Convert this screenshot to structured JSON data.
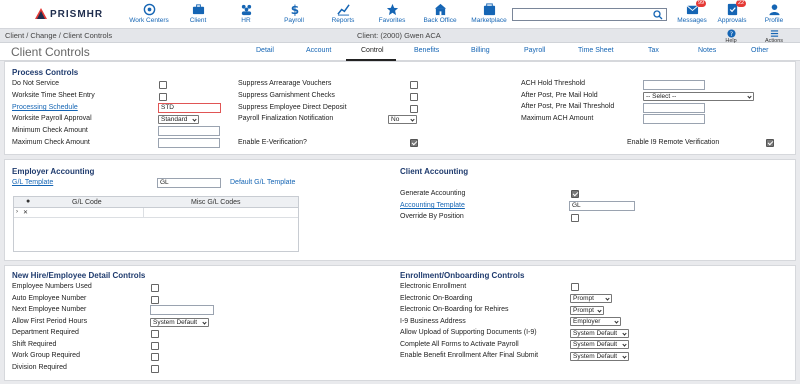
{
  "brand": {
    "name": "PRISMHR"
  },
  "nav": {
    "items": [
      {
        "label": "Work Centers",
        "icon": "work-centers-icon"
      },
      {
        "label": "Client",
        "icon": "client-icon"
      },
      {
        "label": "HR",
        "icon": "hr-icon"
      },
      {
        "label": "Payroll",
        "icon": "payroll-icon"
      },
      {
        "label": "Reports",
        "icon": "reports-icon"
      },
      {
        "label": "Favorites",
        "icon": "star-icon"
      },
      {
        "label": "Back Office",
        "icon": "back-office-icon"
      },
      {
        "label": "Marketplace",
        "icon": "marketplace-icon"
      }
    ],
    "search_value": "",
    "messages": {
      "label": "Messages",
      "count": "99"
    },
    "approvals": {
      "label": "Approvals",
      "count": "22"
    },
    "profile": {
      "label": "Profile"
    }
  },
  "breadcrumb": "Client / Change / Client Controls",
  "client_info": "Client: (2000) Gwen ACA",
  "help_label": "Help",
  "actions_label": "Actions",
  "page_title": "Client Controls",
  "tabs": [
    "Detail",
    "Account",
    "Control",
    "Benefits",
    "Billing",
    "Payroll",
    "Time Sheet",
    "Tax",
    "Notes",
    "Other"
  ],
  "active_tab": "Control",
  "process_controls": {
    "title": "Process Controls",
    "do_not_service": "Do Not Service",
    "worksite_time_sheet_entry": "Worksite Time Sheet Entry",
    "processing_schedule": "Processing Schedule",
    "processing_schedule_value": "STD",
    "worksite_payroll_approval": "Worksite Payroll Approval",
    "worksite_payroll_approval_value": "Standard",
    "minimum_check_amount": "Minimum Check Amount",
    "maximum_check_amount": "Maximum Check Amount",
    "suppress_arrearage_vouchers": "Suppress Arrearage Vouchers",
    "suppress_garnishment_checks": "Suppress Garnishment Checks",
    "suppress_employee_direct_deposit": "Suppress Employee Direct Deposit",
    "payroll_finalization_notification": "Payroll Finalization Notification",
    "payroll_finalization_notification_value": "No",
    "enable_e_verification": "Enable E-Verification?",
    "ach_hold_threshold": "ACH Hold Threshold",
    "after_post_pre_mail_hold": "After Post, Pre Mail Hold",
    "after_post_pre_mail_hold_value": "-- Select --",
    "after_post_pre_mail_threshold": "After Post, Pre Mail Threshold",
    "maximum_ach_amount": "Maximum ACH Amount",
    "enable_i9_remote_verification": "Enable I9 Remote Verification"
  },
  "employer_accounting": {
    "title": "Employer Accounting",
    "gl_template": "G/L Template",
    "gl_template_value": "GL",
    "default_gl_template": "Default G/L Template",
    "grid_headers": [
      "G/L Code",
      "Misc G/L Codes"
    ]
  },
  "client_accounting": {
    "title": "Client Accounting",
    "generate_accounting": "Generate Accounting",
    "accounting_template": "Accounting Template",
    "accounting_template_value": "GL",
    "override_by_position": "Override By Position"
  },
  "new_hire": {
    "title": "New Hire/Employee Detail Controls",
    "employee_numbers_used": "Employee Numbers Used",
    "auto_employee_number": "Auto Employee Number",
    "next_employee_number": "Next Employee Number",
    "allow_first_period_hours": "Allow First Period Hours",
    "allow_first_period_hours_value": "System Default",
    "department_required": "Department Required",
    "shift_required": "Shift Required",
    "work_group_required": "Work Group Required",
    "division_required": "Division Required"
  },
  "enrollment": {
    "title": "Enrollment/Onboarding Controls",
    "electronic_enrollment": "Electronic Enrollment",
    "electronic_onboarding": "Electronic On-Boarding",
    "electronic_onboarding_value": "Prompt",
    "electronic_onboarding_rehires": "Electronic On-Boarding for Rehires",
    "electronic_onboarding_rehires_value": "Prompt",
    "i9_business_address": "I-9 Business Address",
    "i9_business_address_value": "Employer",
    "allow_upload_supporting_docs": "Allow Upload of Supporting Documents (I-9)",
    "allow_upload_supporting_docs_value": "System Default",
    "complete_all_forms": "Complete All Forms to Activate Payroll",
    "complete_all_forms_value": "System Default",
    "enable_benefit_enrollment": "Enable Benefit Enrollment After Final Submit",
    "enable_benefit_enrollment_value": "System Default"
  },
  "colors": {
    "link": "#1565b4",
    "section_title": "#1f3b6e",
    "badge": "#e53935"
  }
}
